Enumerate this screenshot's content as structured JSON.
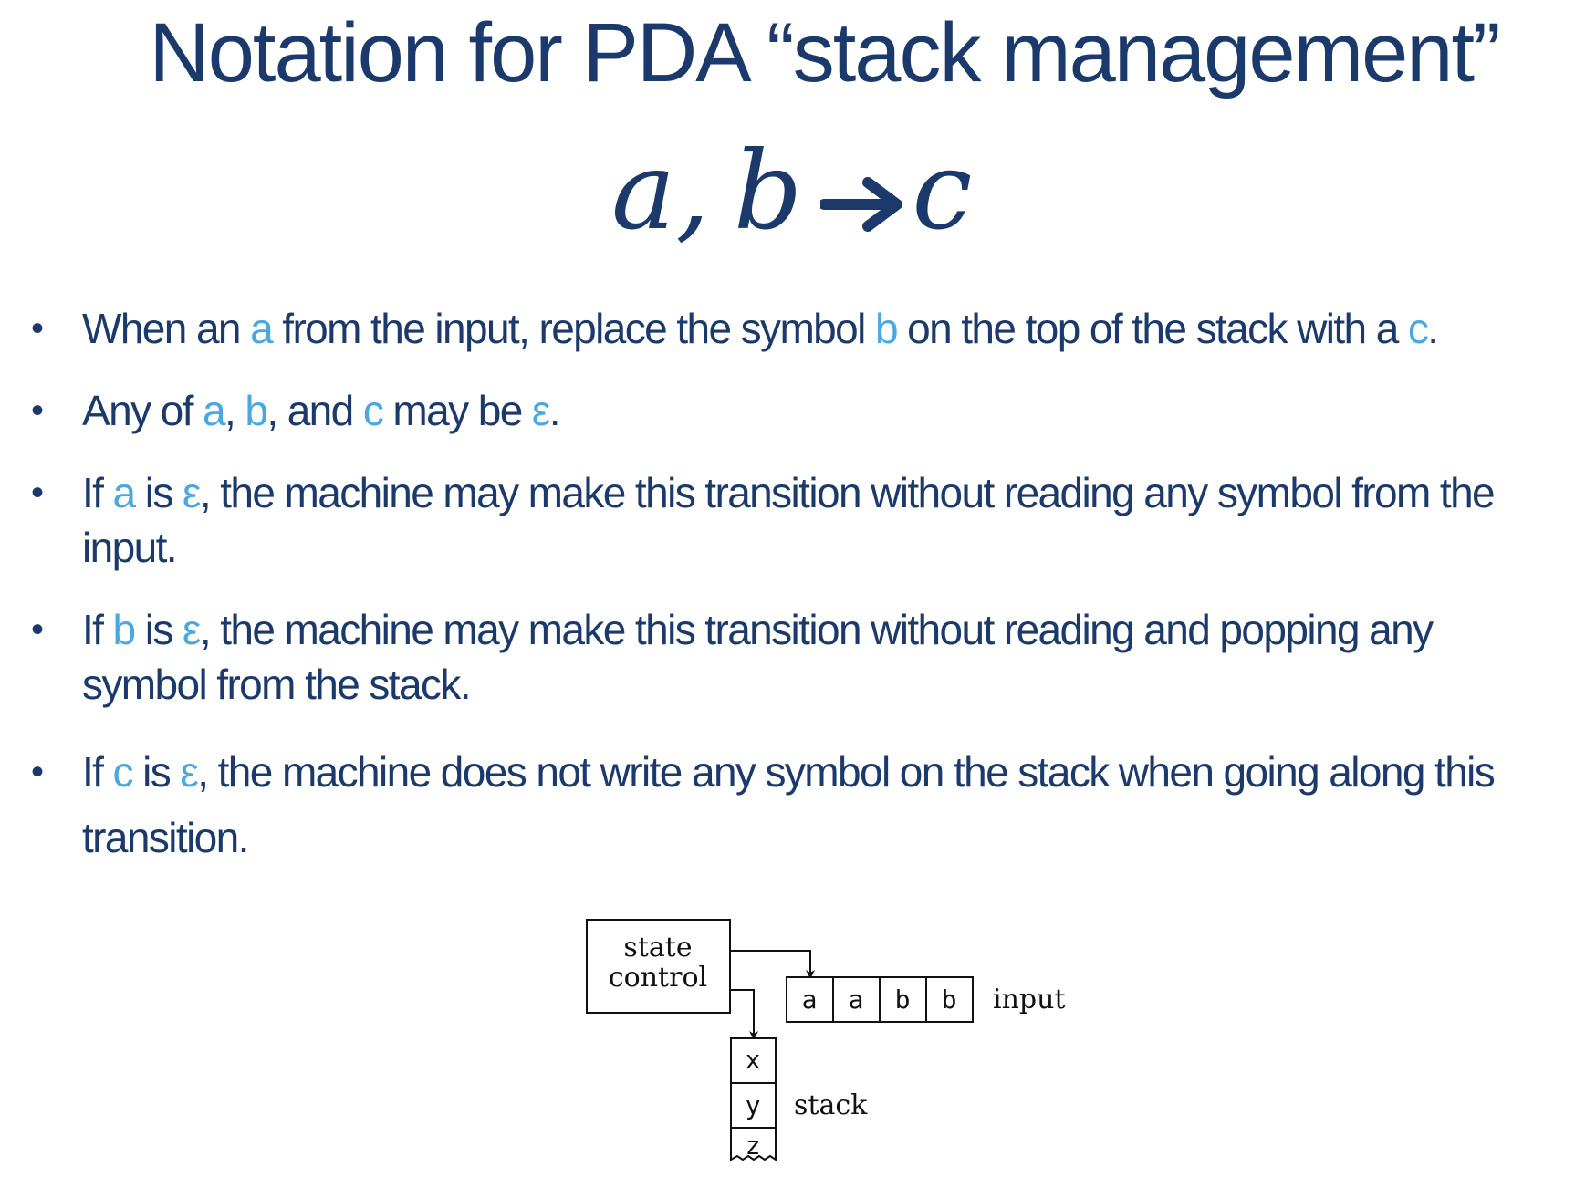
{
  "slide": {
    "title": "Notation for PDA “stack management”",
    "formula": {
      "a": "a",
      "comma": ",",
      "b": "b",
      "c": "c",
      "arrow_icon": "right-arrow-icon"
    },
    "bullets": [
      {
        "parts": [
          {
            "t": "When an ",
            "hl": false
          },
          {
            "t": "a",
            "hl": true
          },
          {
            "t": " from the input, replace the symbol ",
            "hl": false
          },
          {
            "t": "b",
            "hl": true
          },
          {
            "t": " on the top of the stack with a ",
            "hl": false
          },
          {
            "t": "c",
            "hl": true
          },
          {
            "t": ".",
            "hl": false
          }
        ]
      },
      {
        "parts": [
          {
            "t": "Any of ",
            "hl": false
          },
          {
            "t": "a",
            "hl": true
          },
          {
            "t": ", ",
            "hl": false
          },
          {
            "t": "b",
            "hl": true
          },
          {
            "t": ", and ",
            "hl": false
          },
          {
            "t": "c",
            "hl": true
          },
          {
            "t": " may be ",
            "hl": false
          },
          {
            "t": "ε",
            "hl": true
          },
          {
            "t": ".",
            "hl": false
          }
        ]
      },
      {
        "parts": [
          {
            "t": "If ",
            "hl": false
          },
          {
            "t": "a",
            "hl": true
          },
          {
            "t": " is ",
            "hl": false
          },
          {
            "t": "ε",
            "hl": true
          },
          {
            "t": ", the machine may make this transition without reading any symbol from the input.",
            "hl": false
          }
        ]
      },
      {
        "parts": [
          {
            "t": "If ",
            "hl": false
          },
          {
            "t": "b",
            "hl": true
          },
          {
            "t": " is ",
            "hl": false
          },
          {
            "t": "ε",
            "hl": true
          },
          {
            "t": ", the machine may make this transition without reading and popping any symbol from the stack.",
            "hl": false
          }
        ]
      },
      {
        "parts": [
          {
            "t": "If ",
            "hl": false
          },
          {
            "t": "c",
            "hl": true
          },
          {
            "t": " is ",
            "hl": false
          },
          {
            "t": "ε",
            "hl": true
          },
          {
            "t": ", the machine does not write any symbol on the stack when going along this transition.",
            "hl": false
          }
        ]
      }
    ],
    "diagram": {
      "state_control_line1": "state",
      "state_control_line2": "control",
      "input_cells": [
        "a",
        "a",
        "b",
        "b"
      ],
      "input_label": "input",
      "stack_cells": [
        "x",
        "y",
        "z"
      ],
      "stack_label": "stack"
    },
    "colors": {
      "text": "#1b3a6b",
      "highlight": "#4aa7e0"
    }
  }
}
